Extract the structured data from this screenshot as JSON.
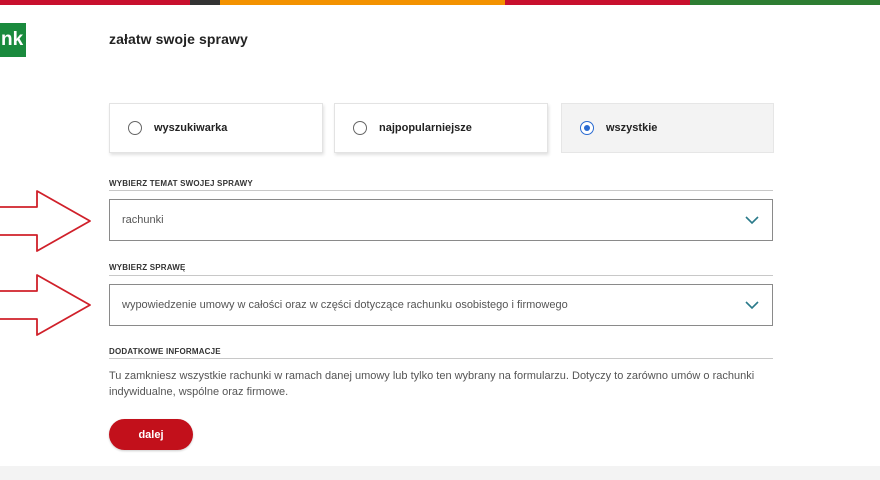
{
  "brand": {
    "logo_text": "nk",
    "logo_color": "#1a8a3d",
    "stripe_colors": [
      "#c8102e",
      "#333333",
      "#f39200",
      "#c8102e",
      "#2e7d32"
    ]
  },
  "page": {
    "title": "załatw swoje sprawy"
  },
  "tabs": [
    {
      "label": "wyszukiwarka",
      "selected": false
    },
    {
      "label": "najpopularniejsze",
      "selected": false
    },
    {
      "label": "wszystkie",
      "selected": true
    }
  ],
  "topic": {
    "label": "WYBIERZ TEMAT SWOJEJ SPRAWY",
    "value": "rachunki"
  },
  "matter": {
    "label": "WYBIERZ SPRAWĘ",
    "value": "wypowiedzenie umowy w całości oraz w części dotyczące rachunku osobistego i firmowego"
  },
  "additional_info": {
    "label": "DODATKOWE INFORMACJE",
    "text": "Tu zamkniesz wszystkie rachunki w ramach danej umowy lub tylko ten wybrany na formularzu. Dotyczy to zarówno umów o rachunki indywidualne, wspólne oraz firmowe."
  },
  "actions": {
    "next_label": "dalej",
    "next_color": "#c2101b"
  },
  "accent_colors": {
    "radio_selected": "#2a6bd1",
    "chevron": "#2a7a8a",
    "annotation_arrow": "#d0202a"
  }
}
